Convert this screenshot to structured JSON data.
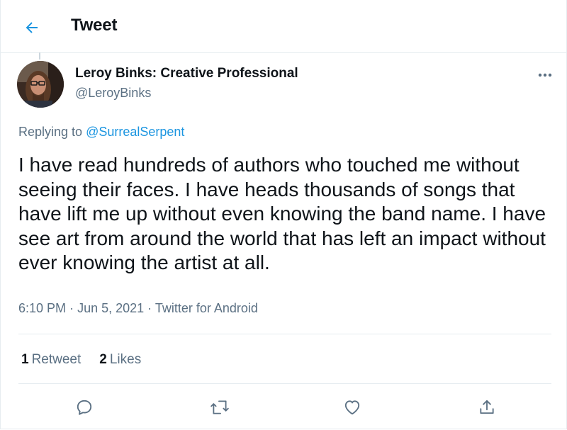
{
  "header": {
    "title": "Tweet",
    "back_icon": "arrow-left-icon"
  },
  "author": {
    "name": "Leroy Binks: Creative Professional",
    "handle": "@LeroyBinks"
  },
  "reply": {
    "prefix": "Replying to",
    "target": "@SurrealSerpent"
  },
  "tweet": {
    "text": "I have read hundreds of authors who touched me without seeing their faces. I have heads thousands of songs that have lift me up without even knowing the band name. I have see art from around the world that has left an impact without ever knowing the artist at all.",
    "time": "6:10 PM",
    "date": "Jun 5, 2021",
    "source": "Twitter for Android",
    "separator": "·"
  },
  "stats": {
    "retweets_count": "1",
    "retweets_label": "Retweet",
    "likes_count": "2",
    "likes_label": "Likes"
  },
  "actions": [
    {
      "icon": "reply-icon"
    },
    {
      "icon": "retweet-icon"
    },
    {
      "icon": "like-icon"
    },
    {
      "icon": "share-icon"
    }
  ],
  "colors": {
    "accent": "#1b95e0",
    "text": "#0f1419",
    "secondary": "#5b7083",
    "border": "#e6ecf0"
  }
}
